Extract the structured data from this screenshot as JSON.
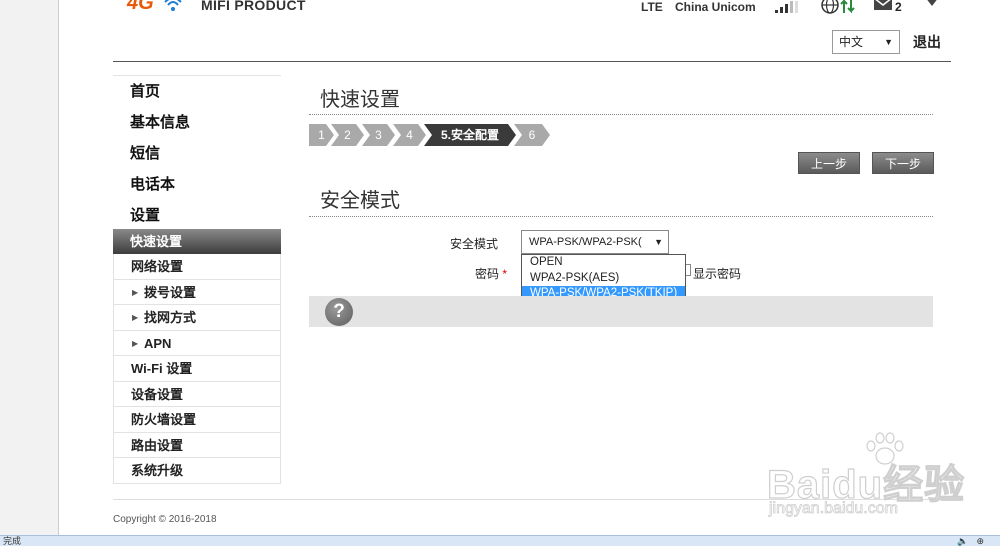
{
  "header": {
    "logo_4g": "4G",
    "product_name": "MIFI PRODUCT",
    "network_type": "LTE",
    "carrier": "China Unicom",
    "message_count": "2",
    "language": "中文",
    "logout": "退出"
  },
  "sidebar": {
    "top_items": [
      {
        "label": "首页"
      },
      {
        "label": "基本信息"
      },
      {
        "label": "短信"
      },
      {
        "label": "电话本"
      },
      {
        "label": "设置"
      }
    ],
    "sub_items": [
      {
        "label": "快速设置",
        "active": true
      },
      {
        "label": "网络设置"
      },
      {
        "label": "拨号设置",
        "child": true
      },
      {
        "label": "找网方式",
        "child": true
      },
      {
        "label": "APN",
        "child": true
      },
      {
        "label": "Wi-Fi 设置"
      },
      {
        "label": "设备设置"
      },
      {
        "label": "防火墙设置"
      },
      {
        "label": "路由设置"
      },
      {
        "label": "系统升级"
      }
    ]
  },
  "main": {
    "title": "快速设置",
    "steps": [
      "1",
      "2",
      "3",
      "4",
      "5.安全配置",
      "6"
    ],
    "current_step": 4,
    "prev_button": "上一步",
    "next_button": "下一步",
    "section_title": "安全模式",
    "security_mode_label": "安全模式",
    "security_mode_value": "WPA-PSK/WPA2-PSK(",
    "security_options": [
      "OPEN",
      "WPA2-PSK(AES)",
      "WPA-PSK/WPA2-PSK(TKIP)"
    ],
    "selected_option": 2,
    "password_label": "密码",
    "required_mark": "*",
    "show_password": "显示密码",
    "help_symbol": "?"
  },
  "footer": {
    "copyright": "Copyright © 2016-2018"
  },
  "watermark": {
    "logo": "Bai",
    "logo_du": "du",
    "logo_cn": "经验",
    "url": "jingyan.baidu.com"
  },
  "status_bar": {
    "text": "完成"
  },
  "colors": {
    "accent_orange": "#e8590c",
    "selection_blue": "#3399ff",
    "active_nav": "#3c3c3c"
  }
}
